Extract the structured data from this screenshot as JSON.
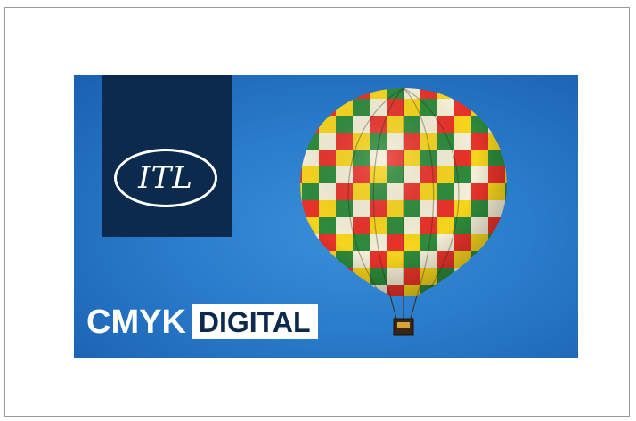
{
  "logo": {
    "text": "ITL",
    "colors": {
      "background": "#0c2a4d",
      "foreground": "#ffffff"
    }
  },
  "brand": {
    "part1": "CMYK",
    "part2": "DIGITAL"
  },
  "banner": {
    "image": "hot-air-balloon",
    "sky_color": "#2a7ccc"
  }
}
